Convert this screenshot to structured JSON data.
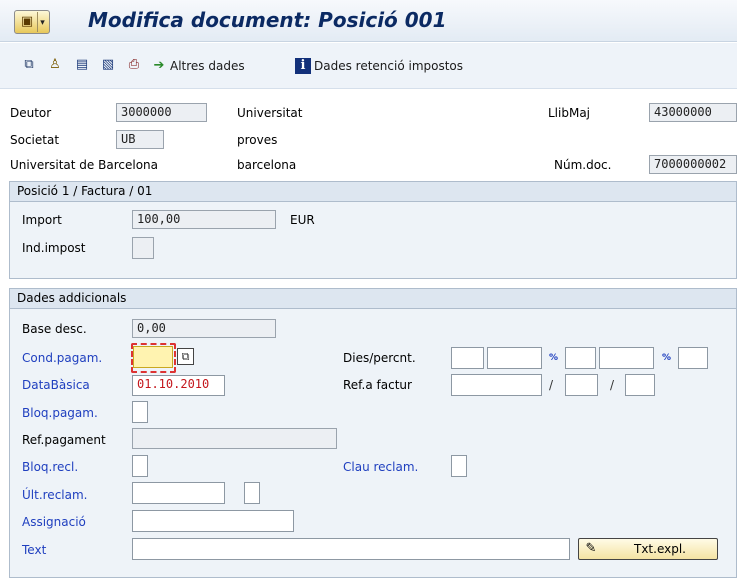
{
  "title": "Modifica document: Posició 001",
  "toolbar": {
    "icons": [
      "copy-icon",
      "person-icon",
      "save-icon",
      "document-icon",
      "print-icon"
    ],
    "altres_dades": "Altres dades",
    "dades_retencio": "Dades retenció impostos"
  },
  "header": {
    "deutor_label": "Deutor",
    "deutor_value": "3000000",
    "deutor_name": "Universitat",
    "societat_label": "Societat",
    "societat_value": "UB",
    "societat_name": "proves",
    "company_name": "Universitat de Barcelona",
    "city": "barcelona",
    "llibmaj_label": "LlibMaj",
    "llibmaj_value": "43000000",
    "numdoc_label": "Núm.doc.",
    "numdoc_value": "7000000002"
  },
  "posicio": {
    "title": "Posició 1 / Factura / 01",
    "import_label": "Import",
    "import_value": "100,00",
    "currency": "EUR",
    "indimpost_label": "Ind.impost",
    "indimpost_value": ""
  },
  "addicionals": {
    "title": "Dades addicionals",
    "base_desc_label": "Base desc.",
    "base_desc_value": "0,00",
    "cond_pagam_label": "Cond.pagam.",
    "cond_pagam_value": "",
    "dies_label": "Dies/percnt.",
    "databasica_label": "DataBàsica",
    "databasica_value": "01.10.2010",
    "ref_factur_label": "Ref.a factur",
    "bloq_pagam_label": "Bloq.pagam.",
    "ref_pagament_label": "Ref.pagament",
    "bloq_recl_label": "Bloq.recl.",
    "clau_reclam_label": "Clau reclam.",
    "ult_reclam_label": "Últ.reclam.",
    "assignacio_label": "Assignació",
    "text_label": "Text",
    "text_value": "",
    "txt_expl_label": "Txt.expl.",
    "percent_sign": "%",
    "slash": "/"
  },
  "colors": {
    "title": "#0b2a63",
    "link_label": "#1f3fbf",
    "date_value": "#c4161c",
    "group_bg": "#eef3f8"
  }
}
